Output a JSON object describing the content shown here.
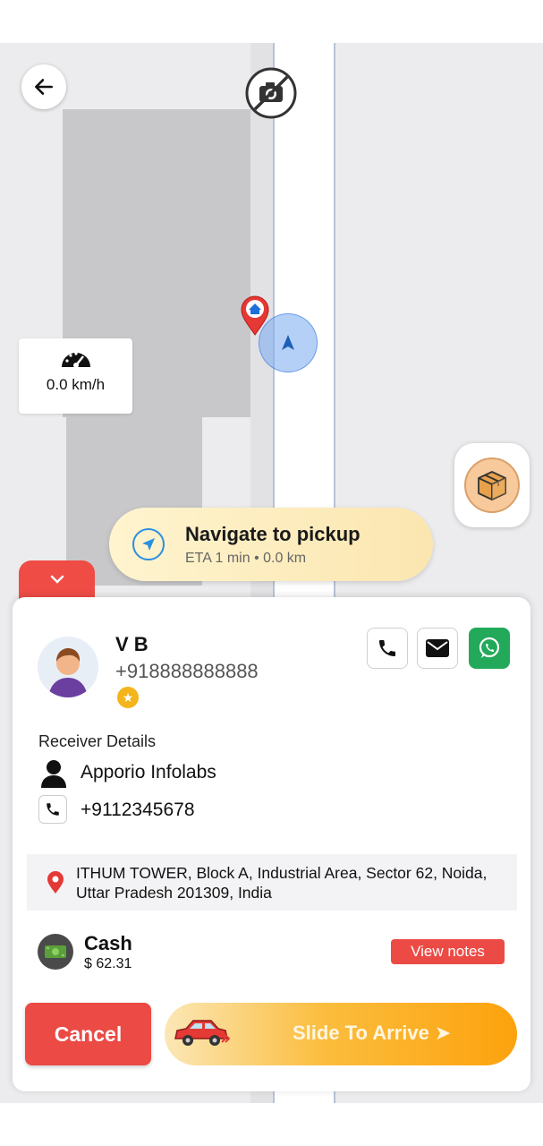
{
  "navigation": {
    "title": "Navigate to pickup",
    "eta": "ETA 1 min • 0.0 km"
  },
  "speed": {
    "value": "0.0 km/h"
  },
  "customer": {
    "name": "V B",
    "phone": "+918888888888"
  },
  "receiver": {
    "section_label": "Receiver Details",
    "name": "Apporio Infolabs",
    "phone": "+9112345678"
  },
  "address": {
    "text": "ITHUM TOWER, Block A, Industrial Area, Sector 62, Noida, Uttar Pradesh 201309, India"
  },
  "payment": {
    "method": "Cash",
    "amount": "$ 62.31",
    "notes_label": "View notes"
  },
  "actions": {
    "cancel_label": "Cancel",
    "slide_label": "Slide To Arrive ➤"
  },
  "icons": {
    "back": "back-arrow-icon",
    "camera_off": "camera-off-icon",
    "speedometer": "speedometer-icon",
    "home_pin": "home-pin-icon",
    "locator": "navigation-arrow-icon",
    "parcel": "parcel-box-icon",
    "collapse": "chevron-down-icon",
    "call": "phone-icon",
    "mail": "mail-icon",
    "whatsapp": "whatsapp-icon",
    "star": "star-icon",
    "person": "person-icon",
    "pin": "location-pin-icon",
    "cash": "cash-icon",
    "car": "car-icon"
  },
  "colors": {
    "accent_red": "#ec4a45",
    "whatsapp_green": "#22a95a",
    "nav_blue": "#2a8fe0",
    "slide_orange": "#fca20d"
  }
}
